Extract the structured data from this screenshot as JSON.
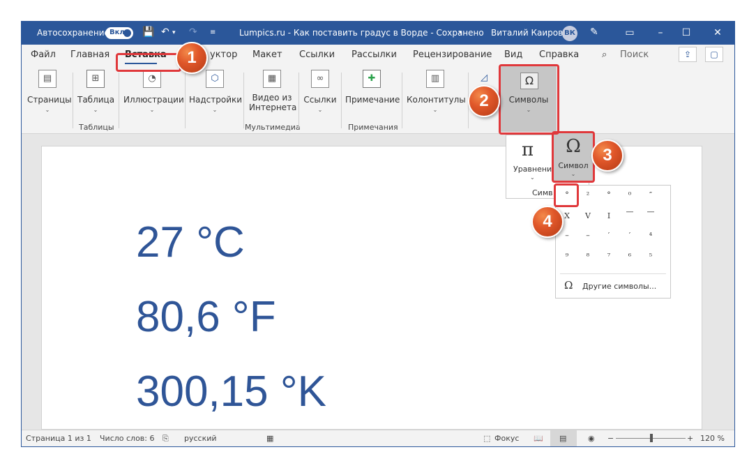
{
  "titlebar": {
    "autosave_label": "Автосохранение",
    "autosave_state": "Вкл.",
    "document_title": "Lumpics.ru - Как поставить градус в Ворде - Сохранено",
    "user_name": "Виталий Каиров",
    "user_initials": "ВК"
  },
  "tabs": [
    "Файл",
    "Главная",
    "Вставка",
    "уктор",
    "Макет",
    "Ссылки",
    "Рассылки",
    "Рецензирование",
    "Вид",
    "Справка"
  ],
  "active_tab": "Вставка",
  "search_label": "Поиск",
  "ribbon": {
    "pages": "Страницы",
    "table": "Таблица",
    "tables_group": "Таблицы",
    "illustrations": "Иллюстрации",
    "addins": "Надстройки",
    "video_line1": "Видео из",
    "video_line2": "Интернета",
    "media_group": "Мультимедиа",
    "links": "Ссылки",
    "comment": "Примечание",
    "comments_group": "Примечания",
    "headers_footers": "Колонтитулы",
    "symbols": "Символы"
  },
  "symbols_panel": {
    "equation": "Уравнени",
    "symbol": "Символ",
    "group_label": "Симв"
  },
  "symbol_grid": [
    [
      "°",
      "²",
      "°",
      "⁰",
      "″"
    ],
    [
      "Х",
      "Ⅴ",
      "Ⅰ",
      "—",
      "—"
    ],
    [
      "–",
      "–",
      "′",
      "′",
      "⁴"
    ],
    [
      "⁹",
      "⁸",
      "⁷",
      "⁶",
      "⁵"
    ]
  ],
  "more_symbols": "Другие символы...",
  "document_lines": [
    "27 °C",
    "80,6 °F",
    "300,15 °K"
  ],
  "statusbar": {
    "page": "Страница 1 из 1",
    "words": "Число слов: 6",
    "language": "русский",
    "focus": "Фокус",
    "zoom": "120 %"
  },
  "steps": [
    "1",
    "2",
    "3",
    "4"
  ]
}
